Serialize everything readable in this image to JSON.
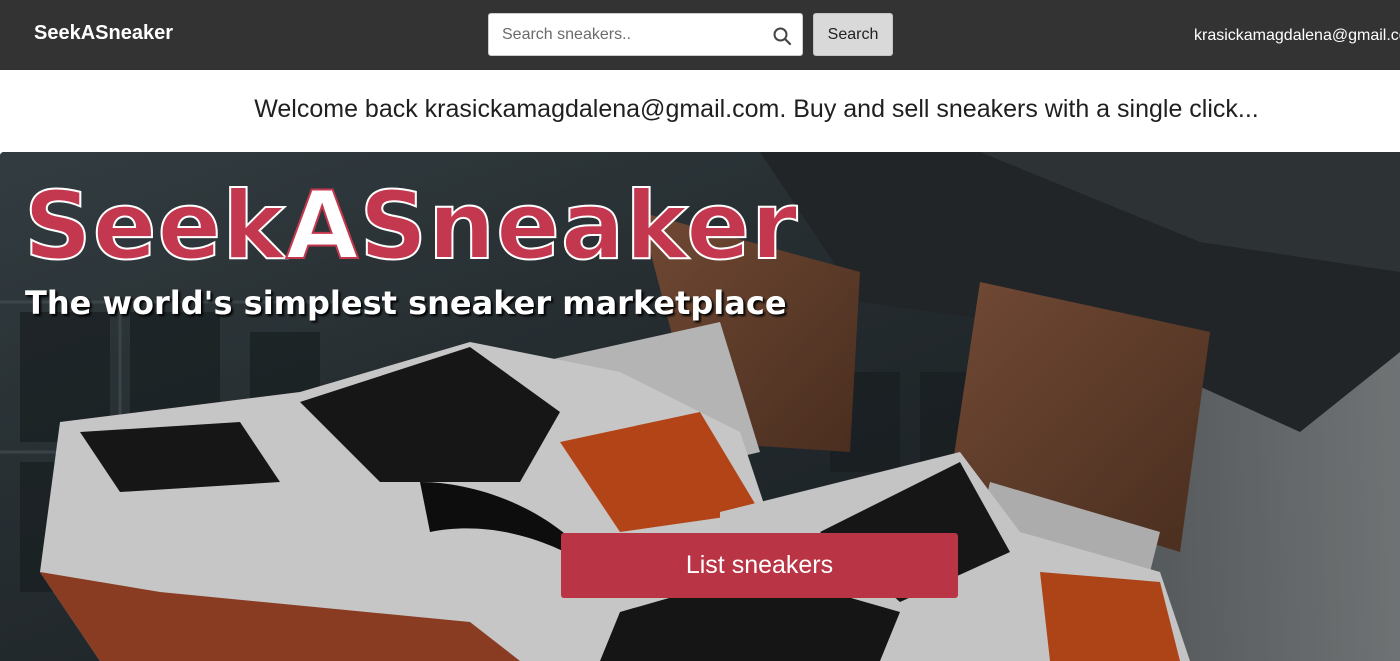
{
  "navbar": {
    "brand": "SeekASneaker",
    "search": {
      "placeholder": "Search sneakers..",
      "value": ""
    },
    "search_button": "Search",
    "user_email": "krasickamagdalena@gmail.com"
  },
  "welcome": {
    "text": "Welcome back krasickamagdalena@gmail.com. Buy and sell sneakers with a single click..."
  },
  "hero": {
    "title_part1": "Seek",
    "title_accent": "A",
    "title_part2": "Sneaker",
    "subtitle": "The world's simplest sneaker marketplace",
    "cta_button": "List sneakers",
    "image": "sneakers-hero-photo"
  },
  "colors": {
    "navbar_bg": "#333333",
    "brand_accent": "#c4384f",
    "cta_bg": "#b93444"
  },
  "icons": {
    "search": "search-icon"
  }
}
